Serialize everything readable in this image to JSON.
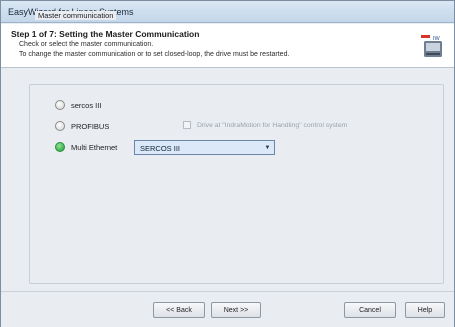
{
  "window": {
    "title": "EasyWizard for Linear Systems"
  },
  "header": {
    "step_title": "Step 1 of 7: Setting the Master Communication",
    "line1": "Check or select the master communication.",
    "line2": "To change the master communication or to set closed-loop, the drive must be restarted.",
    "icon": "drive-device-icon"
  },
  "group": {
    "legend": "Master communication",
    "options": [
      {
        "label": "sercos III",
        "selected": false
      },
      {
        "label": "PROFIBUS",
        "selected": false
      },
      {
        "label": "Multi Ethernet",
        "selected": true
      }
    ],
    "checkbox": {
      "label": "Drive at \"IndraMotion for Handling\" control system",
      "checked": false,
      "enabled": false
    },
    "protocol_select": {
      "value": "SERCOS III"
    }
  },
  "footer": {
    "back_label": "<< Back",
    "next_label": "Next >>",
    "cancel_label": "Cancel",
    "help_label": "Help"
  },
  "colors": {
    "selected_radio": "#1f9a33",
    "window_bg": "#e9edf2",
    "select_bg": "#dbe8f7"
  }
}
